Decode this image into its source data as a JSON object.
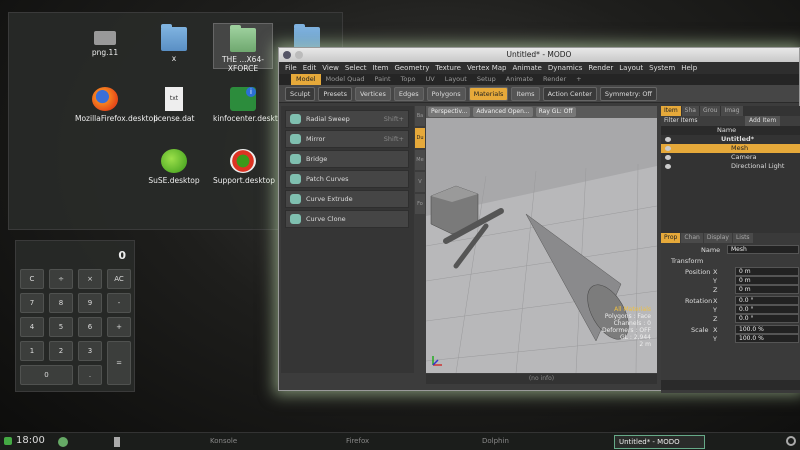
{
  "desktop": {
    "icons": [
      {
        "label": "png.11",
        "kind": "folder"
      },
      {
        "label": "x",
        "kind": "folder"
      },
      {
        "label": "THE ...X64-XFORCE",
        "kind": "folder-green"
      },
      {
        "label": "",
        "kind": "folder"
      },
      {
        "label": "MozillaFirefox.desktop",
        "kind": "firefox"
      },
      {
        "label": "license.dat",
        "kind": "text"
      },
      {
        "label": "kinfocenter.desktop",
        "kind": "info"
      },
      {
        "label": "SuSE.desktop",
        "kind": "suse"
      },
      {
        "label": "Support.desktop",
        "kind": "support"
      }
    ]
  },
  "calculator": {
    "display": "0",
    "buttons": [
      "C",
      "÷",
      "×",
      "AC",
      "7",
      "8",
      "9",
      "-",
      "4",
      "5",
      "6",
      "+",
      "1",
      "2",
      "3",
      "=",
      "0",
      "."
    ]
  },
  "modo": {
    "title": "Untitled* - MODO",
    "menu": [
      "File",
      "Edit",
      "View",
      "Select",
      "Item",
      "Geometry",
      "Texture",
      "Vertex Map",
      "Animate",
      "Dynamics",
      "Render",
      "Layout",
      "System",
      "Help"
    ],
    "layouts": [
      "Model",
      "Model Quad",
      "Paint",
      "Topo",
      "UV",
      "Layout",
      "Setup",
      "Animate",
      "Render",
      "+"
    ],
    "toolbar": {
      "sculpt": "Sculpt",
      "presets": "Presets",
      "vertices": "Vertices",
      "edges": "Edges",
      "polygons": "Polygons",
      "materials": "Materials",
      "items": "Items",
      "action_center": "Action Center",
      "symmetry": "Symmetry: Off"
    },
    "tools": [
      {
        "label": "Radial Sweep",
        "shortcut": "Shift+"
      },
      {
        "label": "Mirror",
        "shortcut": "Shift+"
      },
      {
        "label": "Bridge",
        "shortcut": ""
      },
      {
        "label": "Patch Curves",
        "shortcut": ""
      },
      {
        "label": "Curve Extrude",
        "shortcut": ""
      },
      {
        "label": "Curve Clone",
        "shortcut": ""
      }
    ],
    "vtabs": [
      "Ba",
      "Du",
      "Me",
      "V",
      "Fo"
    ],
    "viewport": {
      "view": "Perspectiv...",
      "mode": "Advanced Open...",
      "ray": "Ray GL: Off",
      "stats": {
        "title": "All Materials",
        "polygons": "Polygons : Face",
        "channels": "Channels : 0",
        "deformers": "Deformers : OFF",
        "gl": "GL : 2,944",
        "scale": "2 m"
      }
    },
    "info": "(no info)",
    "items_panel": {
      "tabs": [
        "Item",
        "Sha",
        "Grou",
        "Imag"
      ],
      "filter_label": "Filter Items",
      "add_label": "Add Item",
      "name_header": "Name",
      "rows": [
        "Untitled*",
        "Mesh",
        "Camera",
        "Directional Light"
      ]
    },
    "props_panel": {
      "tabs": [
        "Prop",
        "Chan",
        "Display",
        "Lists"
      ],
      "name_label": "Name",
      "name_value": "Mesh",
      "transform": "Transform",
      "position_label": "Position",
      "position": [
        "0 m",
        "0 m",
        "0 m"
      ],
      "rotation_label": "Rotation",
      "rotation": [
        "0.0 °",
        "0.0 °",
        "0.0 °"
      ],
      "scale_label": "Scale",
      "scale": [
        "100.0 %",
        "100.0 %"
      ],
      "axes": [
        "X",
        "Y",
        "Z"
      ]
    }
  },
  "taskbar": {
    "clock": "18:00",
    "tasks": [
      "Konsole",
      "Firefox",
      "Dolphin",
      "Untitled* - MODO"
    ]
  }
}
